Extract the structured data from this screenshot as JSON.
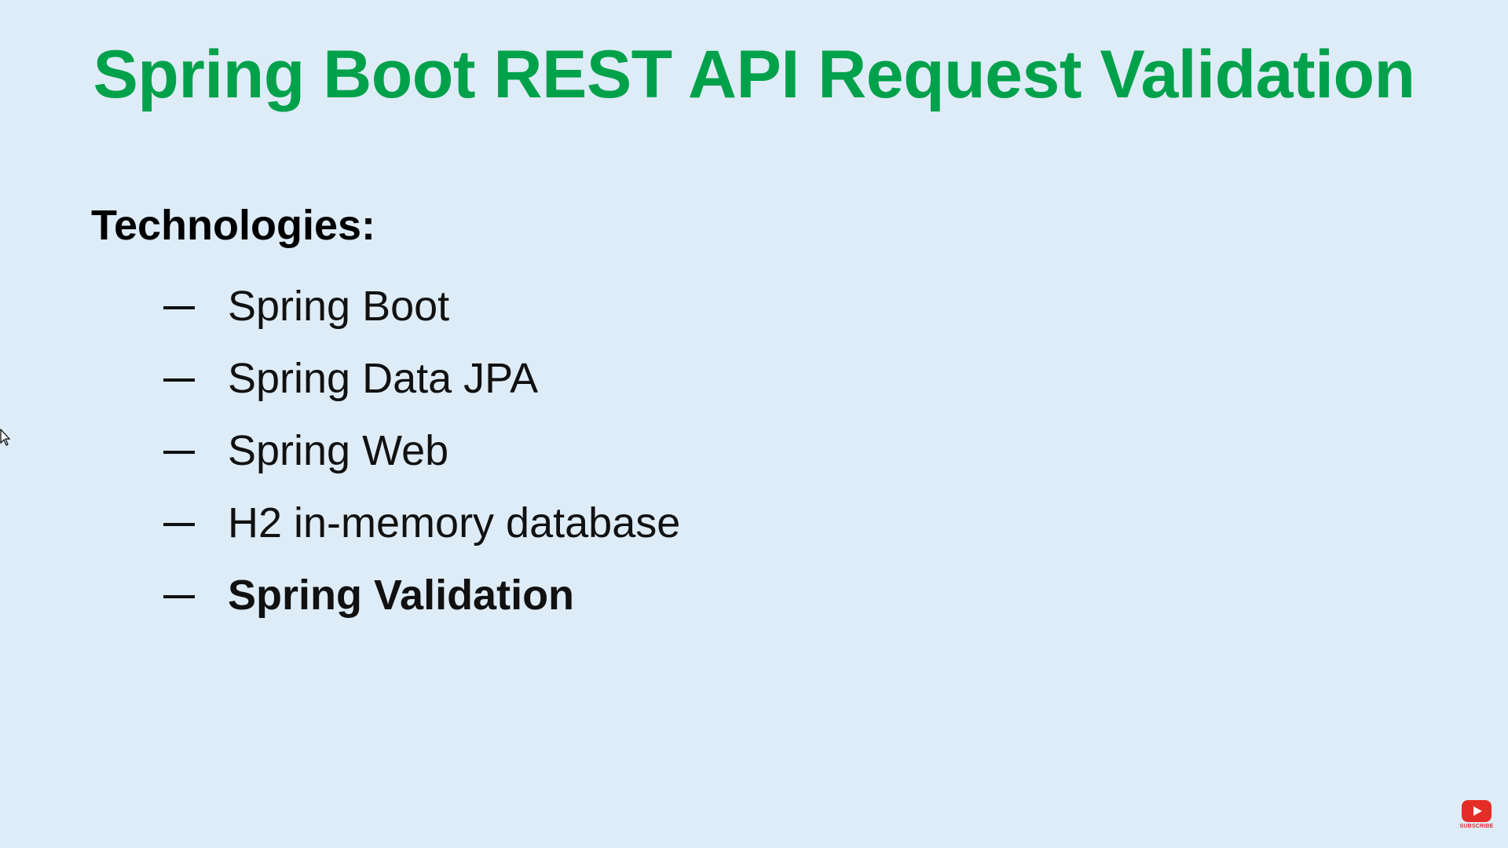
{
  "slide": {
    "title": "Spring Boot REST API Request Validation",
    "heading": "Technologies:",
    "items": [
      {
        "label": "Spring Boot",
        "bold": false
      },
      {
        "label": "Spring Data JPA",
        "bold": false
      },
      {
        "label": "Spring Web",
        "bold": false
      },
      {
        "label": "H2 in-memory database",
        "bold": false
      },
      {
        "label": "Spring Validation",
        "bold": true
      }
    ]
  },
  "overlay": {
    "subscribe_label": "SUBSCRIBE",
    "subscribe_icon": "youtube-play-icon",
    "cursor_icon": "mouse-pointer-icon"
  },
  "colors": {
    "background": "#deecf7",
    "title": "#00a14b",
    "subscribe": "#e52d27"
  }
}
